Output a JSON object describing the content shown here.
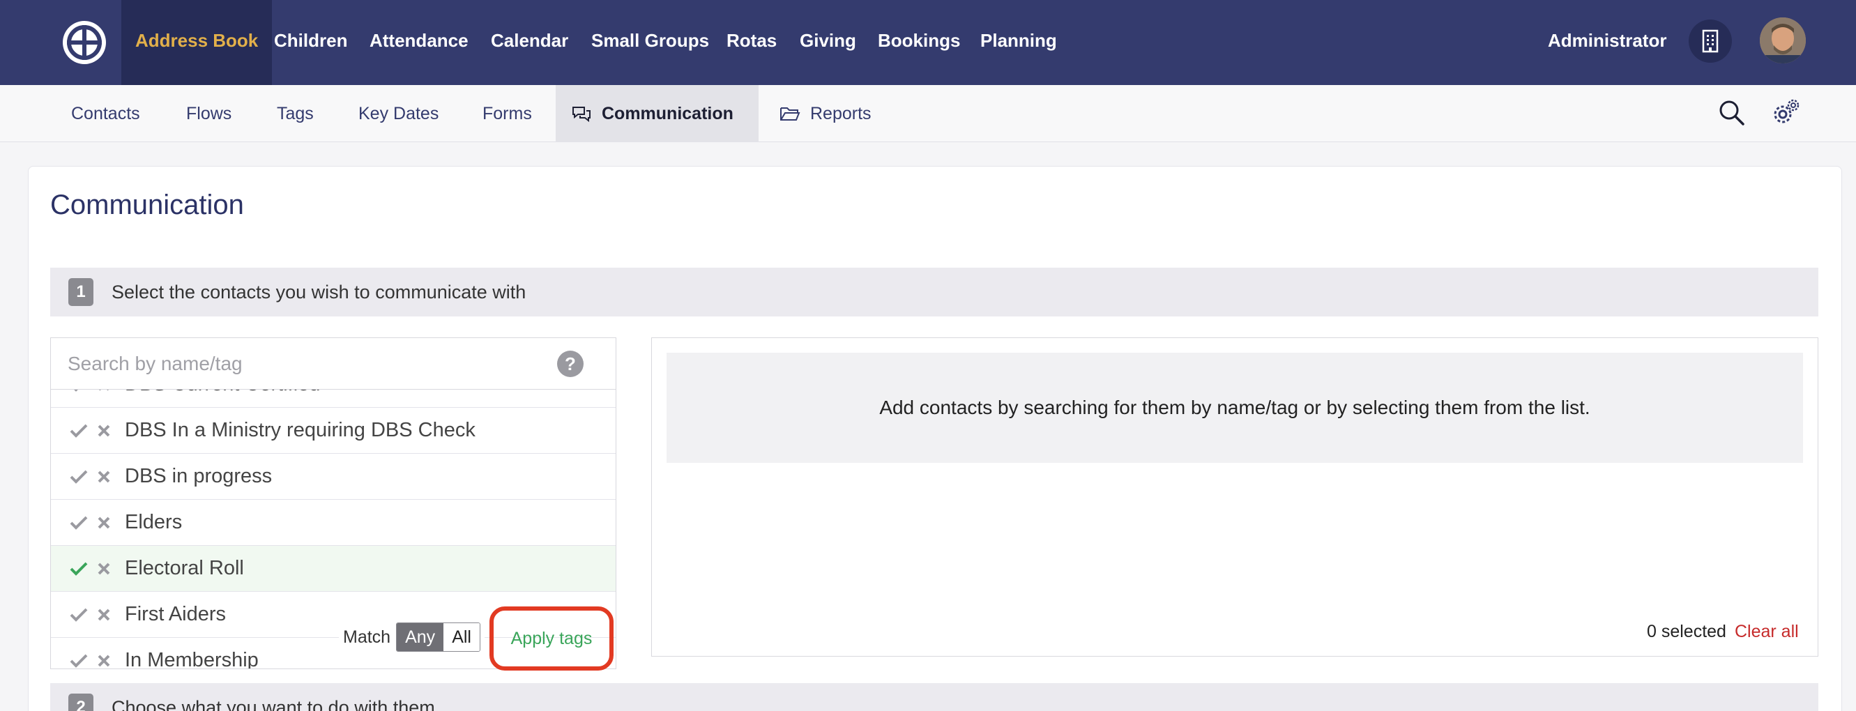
{
  "topnav": {
    "items": [
      {
        "label": "Address Book",
        "active": true
      },
      {
        "label": "Children"
      },
      {
        "label": "Attendance"
      },
      {
        "label": "Calendar"
      },
      {
        "label": "Small Groups"
      },
      {
        "label": "Rotas"
      },
      {
        "label": "Giving"
      },
      {
        "label": "Bookings"
      },
      {
        "label": "Planning"
      }
    ],
    "user": "Administrator"
  },
  "subnav": {
    "items": [
      {
        "label": "Contacts"
      },
      {
        "label": "Flows"
      },
      {
        "label": "Tags"
      },
      {
        "label": "Key Dates"
      },
      {
        "label": "Forms"
      },
      {
        "label": "Communication",
        "active": true,
        "icon": "chat-icon"
      },
      {
        "label": "Reports",
        "icon": "folder-open-icon"
      }
    ]
  },
  "page": {
    "title": "Communication",
    "step1": {
      "num": "1",
      "text": "Select the contacts you wish to communicate with"
    },
    "step2": {
      "num": "2",
      "text": "Choose what you want to do with them"
    }
  },
  "tags": {
    "search_placeholder": "Search by name/tag",
    "help": "?",
    "items": [
      {
        "label": "DBS Current Certified",
        "state": "partial"
      },
      {
        "label": "DBS In a Ministry requiring DBS Check"
      },
      {
        "label": "DBS in progress"
      },
      {
        "label": "Elders"
      },
      {
        "label": "Electoral Roll",
        "selected": true
      },
      {
        "label": "First Aiders"
      },
      {
        "label": "In Membership"
      }
    ],
    "match_label": "Match",
    "match_any": "Any",
    "match_all": "All",
    "apply_label": "Apply tags"
  },
  "selection": {
    "empty_message": "Add contacts by searching for them by name/tag or by selecting them from the list.",
    "count_text": "0 selected",
    "clear_label": "Clear all"
  },
  "colors": {
    "topbar": "#343b6e",
    "active_nav_text": "#e2b04a",
    "check_selected": "#3aa55a",
    "apply_text": "#3aa55a",
    "clear_text": "#c62b2b",
    "highlight_ring": "#e23a22"
  }
}
